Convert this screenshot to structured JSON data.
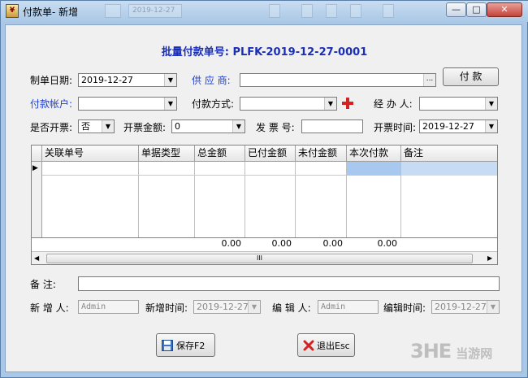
{
  "window": {
    "title": "付款单- 新增",
    "icon_name": "document-app-icon",
    "ghost_toolbar": [
      "2019-12-27"
    ],
    "controls": {
      "minimize": "—",
      "maximize": "□",
      "close": "✕"
    }
  },
  "form": {
    "heading": "批量付款单号: PLFK-2019-12-27-0001",
    "labels": {
      "date": "制单日期:",
      "supplier": "供 应 商:",
      "account": "付款帐户:",
      "method": "付款方式:",
      "handler": "经 办 人:",
      "invoiced": "是否开票:",
      "invoice_amount": "开票金额:",
      "invoice_no": "发 票 号:",
      "invoice_time": "开票时间:",
      "remark": "备    注:",
      "creator": "新 增 人:",
      "create_time": "新增时间:",
      "editor": "编 辑 人:",
      "edit_time": "编辑时间:"
    },
    "values": {
      "date": "2019-12-27",
      "supplier": "",
      "account": "",
      "method": "",
      "handler": "",
      "invoiced": "否",
      "invoice_amount": "0",
      "invoice_no": "",
      "invoice_time": "2019-12-27",
      "remark": "",
      "creator": "Admin",
      "create_time": "2019-12-27",
      "editor": "Admin",
      "edit_time": "2019-12-27"
    },
    "browse_button": "...",
    "pay_button": "付 款"
  },
  "grid": {
    "columns": [
      "关联单号",
      "单据类型",
      "总金额",
      "已付金额",
      "未付金额",
      "本次付款",
      "备注"
    ],
    "totals": [
      "0.00",
      "0.00",
      "0.00",
      "0.00"
    ],
    "scroll_thumb": "III"
  },
  "footer": {
    "save_label": "保存F2",
    "exit_label": "退出Esc"
  },
  "watermark": {
    "text": "3HE当游网"
  },
  "colors": {
    "accent": "#1a2fb5",
    "label_blue": "#1f3fd0",
    "selected_cell": "#a8c8f0"
  }
}
